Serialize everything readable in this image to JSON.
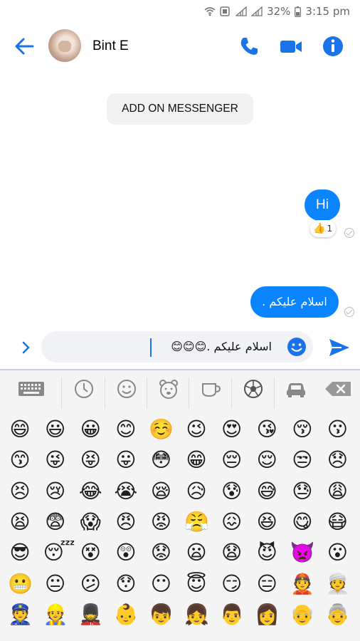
{
  "status_bar": {
    "battery": "32%",
    "time": "3:15 pm"
  },
  "header": {
    "contact_name": "Bint E"
  },
  "banner": {
    "label": "ADD ON MESSENGER"
  },
  "messages": [
    {
      "text": "Hi",
      "reaction_count": "1"
    },
    {
      "text": "اسلام علیکم ."
    }
  ],
  "composer": {
    "text": "اسلام علیکم .😊😊😊"
  },
  "colors": {
    "accent": "#0a84ff",
    "icon": "#1a73e8"
  },
  "keyboard": {
    "tabs": [
      "keyboard-icon",
      "clock-icon",
      "smiley-icon",
      "bear-icon",
      "cup-icon",
      "ball-icon",
      "car-icon",
      "backspace-icon"
    ],
    "emoji_rows": [
      [
        "😄",
        "😃",
        "😀",
        "😊",
        "☺️",
        "😉",
        "😍",
        "😘",
        "😚",
        "😗"
      ],
      [
        "😙",
        "😜",
        "😝",
        "😛",
        "😳",
        "😁",
        "😔",
        "😌",
        "😒",
        "😞"
      ],
      [
        "😣",
        "😢",
        "😂",
        "😭",
        "😪",
        "😥",
        "😰",
        "😅",
        "😓",
        "😩"
      ],
      [
        "😫",
        "😨",
        "😱",
        "😠",
        "😡",
        "😤",
        "😖",
        "😆",
        "😋",
        "😷"
      ],
      [
        "😎",
        "😴",
        "😵",
        "😲",
        "😟",
        "😦",
        "😧",
        "😈",
        "👿",
        "😮"
      ],
      [
        "😬",
        "😐",
        "😕",
        "😯",
        "😶",
        "😇",
        "😏",
        "😑",
        "👲",
        "👳"
      ],
      [
        "👮",
        "👷",
        "💂",
        "👶",
        "👦",
        "👧",
        "👨",
        "👩",
        "👴",
        "👵"
      ]
    ]
  }
}
